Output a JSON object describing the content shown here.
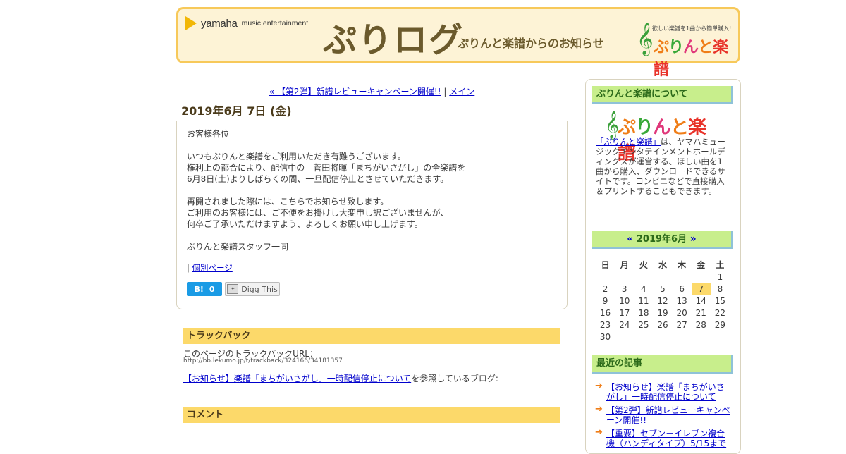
{
  "header": {
    "yamaha_word": "yamaha",
    "yamaha_sub": "music entertainment",
    "blog_title": "ぷりログ",
    "blog_subtitle": "ぷりんと楽譜からのお知らせ",
    "brand_tagline": "欲しい楽譜を1曲から簡単購入!",
    "brand_logo": [
      "ぷ",
      "り",
      "ん",
      "と",
      "楽譜"
    ]
  },
  "nav": {
    "prev_link": "« 【第2弾】新譜レビューキャンペーン開催!!",
    "separator": "|",
    "main_link": "メイン"
  },
  "entry": {
    "date": "2019年6月 7日 (金)",
    "paragraphs": [
      "お客様各位",
      "",
      "いつもぷりんと楽譜をご利用いただき有難うございます。",
      "権利上の都合により、配信中の　菅田将暉「まちがいさがし」の全楽譜を",
      "6月8日(土)よりしばらくの間、一旦配信停止とさせていただきます。",
      "",
      "再開されました際には、こちらでお知らせ致します。",
      "ご利用のお客様には、ご不便をお掛けし大変申し訳ございませんが、",
      "何卒ご了承いただけますよう、よろしくお願い申し上げます。",
      "",
      "ぷりんと楽譜スタッフ一同"
    ],
    "permalink_prefix": "|",
    "permalink_label": "個別ページ",
    "hatena_label": "B!",
    "hatena_count": "0",
    "digg_label": "Digg This"
  },
  "trackback": {
    "heading": "トラックバック",
    "url_label": "このページのトラックバックURL：",
    "url": "http://bb.lekumo.jp/t/trackback/324166/34181357",
    "ref_link": "【お知らせ】楽譜「まちがいさがし」一時配信停止について",
    "ref_suffix": "を参照しているブログ:"
  },
  "comment": {
    "heading": "コメント"
  },
  "sidebar": {
    "about_heading": "ぷりんと楽譜について",
    "about_link": "「ぷりんと楽譜」",
    "about_text": "は、ヤマハミュージックエンタテインメントホールディングスが運営する、ほしい曲を1曲から購入、ダウンロードできるサイトです。コンビニなどで直接購入＆プリントすることもできます。",
    "calendar": {
      "prev": "«",
      "title": "2019年6月",
      "next": "»",
      "weekdays": [
        "日",
        "月",
        "火",
        "水",
        "木",
        "金",
        "土"
      ],
      "weeks": [
        [
          "",
          "",
          "",
          "",
          "",
          "",
          "1"
        ],
        [
          "2",
          "3",
          "4",
          "5",
          "6",
          "7",
          "8"
        ],
        [
          "9",
          "10",
          "11",
          "12",
          "13",
          "14",
          "15"
        ],
        [
          "16",
          "17",
          "18",
          "19",
          "20",
          "21",
          "22"
        ],
        [
          "23",
          "24",
          "25",
          "26",
          "27",
          "28",
          "29"
        ],
        [
          "30",
          "",
          "",
          "",
          "",
          "",
          ""
        ]
      ],
      "today": "7"
    },
    "recent_heading": "最近の記事",
    "recent_items": [
      "【お知らせ】楽譜「まちがいさがし」一時配信停止について",
      "【第2弾】新譜レビューキャンペーン開催!!",
      "【重要】セブン－イレブン複合機（ハンディタイプ）5/15まで"
    ]
  },
  "colors": {
    "banner_bg": "#fdf3d6",
    "banner_border": "#f7c95a",
    "section_head": "#fcd96a",
    "sidebar_head": "#c8ee8c",
    "link": "#0000cc"
  }
}
